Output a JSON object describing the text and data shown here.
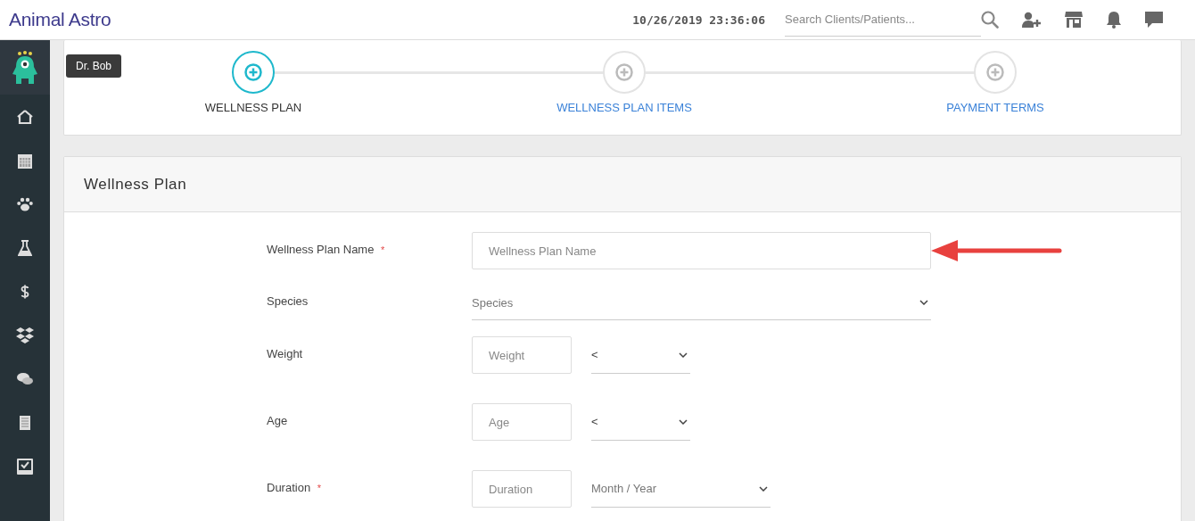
{
  "header": {
    "brand": "Animal Astro",
    "datetime": "10/26/2019 23:36:06",
    "search": {
      "placeholder": "Search Clients/Patients..."
    }
  },
  "user_tooltip": "Dr. Bob",
  "steps": [
    {
      "label": "WELLNESS PLAN",
      "selected": true
    },
    {
      "label": "WELLNESS PLAN ITEMS",
      "selected": false
    },
    {
      "label": "PAYMENT TERMS",
      "selected": false
    }
  ],
  "form": {
    "title": "Wellness Plan",
    "fields": [
      {
        "kind": "text",
        "label": "Wellness Plan Name",
        "required_mark": "*",
        "placeholder": "Wellness Plan Name"
      },
      {
        "kind": "select",
        "label": "Species",
        "select_placeholder": "Species"
      },
      {
        "kind": "compare",
        "label": "Weight",
        "placeholder": "Weight",
        "select_value": "<"
      },
      {
        "kind": "compare",
        "label": "Age",
        "placeholder": "Age",
        "select_value": "<"
      },
      {
        "kind": "period",
        "label": "Duration",
        "required_mark": "*",
        "placeholder": "Duration",
        "select_placeholder": "Month / Year"
      }
    ]
  }
}
